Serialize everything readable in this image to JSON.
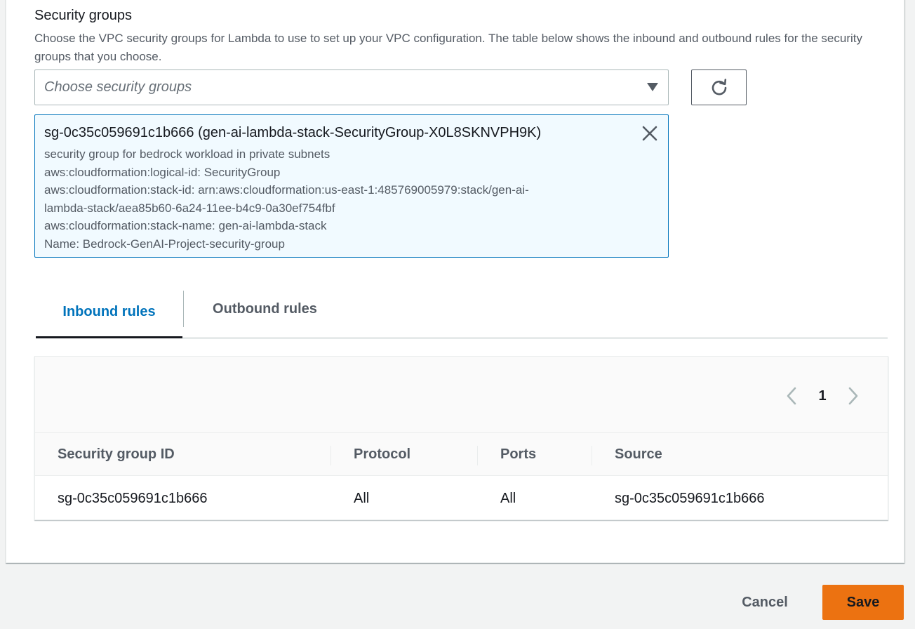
{
  "security_groups": {
    "title": "Security groups",
    "description": "Choose the VPC security groups for Lambda to use to set up your VPC configuration. The table below shows the inbound and outbound rules for the security groups that you choose.",
    "select_placeholder": "Choose security groups",
    "refresh_icon": "refresh-icon",
    "selected": {
      "title": "sg-0c35c059691c1b666 (gen-ai-lambda-stack-SecurityGroup-X0L8SKNVPH9K)",
      "tags": [
        "security group for bedrock workload in private subnets",
        "aws:cloudformation:logical-id: SecurityGroup",
        "aws:cloudformation:stack-id: arn:aws:cloudformation:us-east-1:485769005979:stack/gen-ai-",
        "lambda-stack/aea85b60-6a24-11ee-b4c9-0a30ef754fbf",
        "aws:cloudformation:stack-name: gen-ai-lambda-stack",
        "Name: Bedrock-GenAI-Project-security-group"
      ]
    }
  },
  "tabs": {
    "inbound": "Inbound rules",
    "outbound": "Outbound rules",
    "active": "inbound"
  },
  "table": {
    "pagination": {
      "current_page": "1"
    },
    "columns": [
      "Security group ID",
      "Protocol",
      "Ports",
      "Source"
    ],
    "rows": [
      [
        "sg-0c35c059691c1b666",
        "All",
        "All",
        "sg-0c35c059691c1b666"
      ]
    ]
  },
  "footer": {
    "cancel_label": "Cancel",
    "save_label": "Save"
  },
  "colors": {
    "accent": "#0073bb",
    "primary_button": "#ec7211",
    "token_background": "#f1faff"
  }
}
